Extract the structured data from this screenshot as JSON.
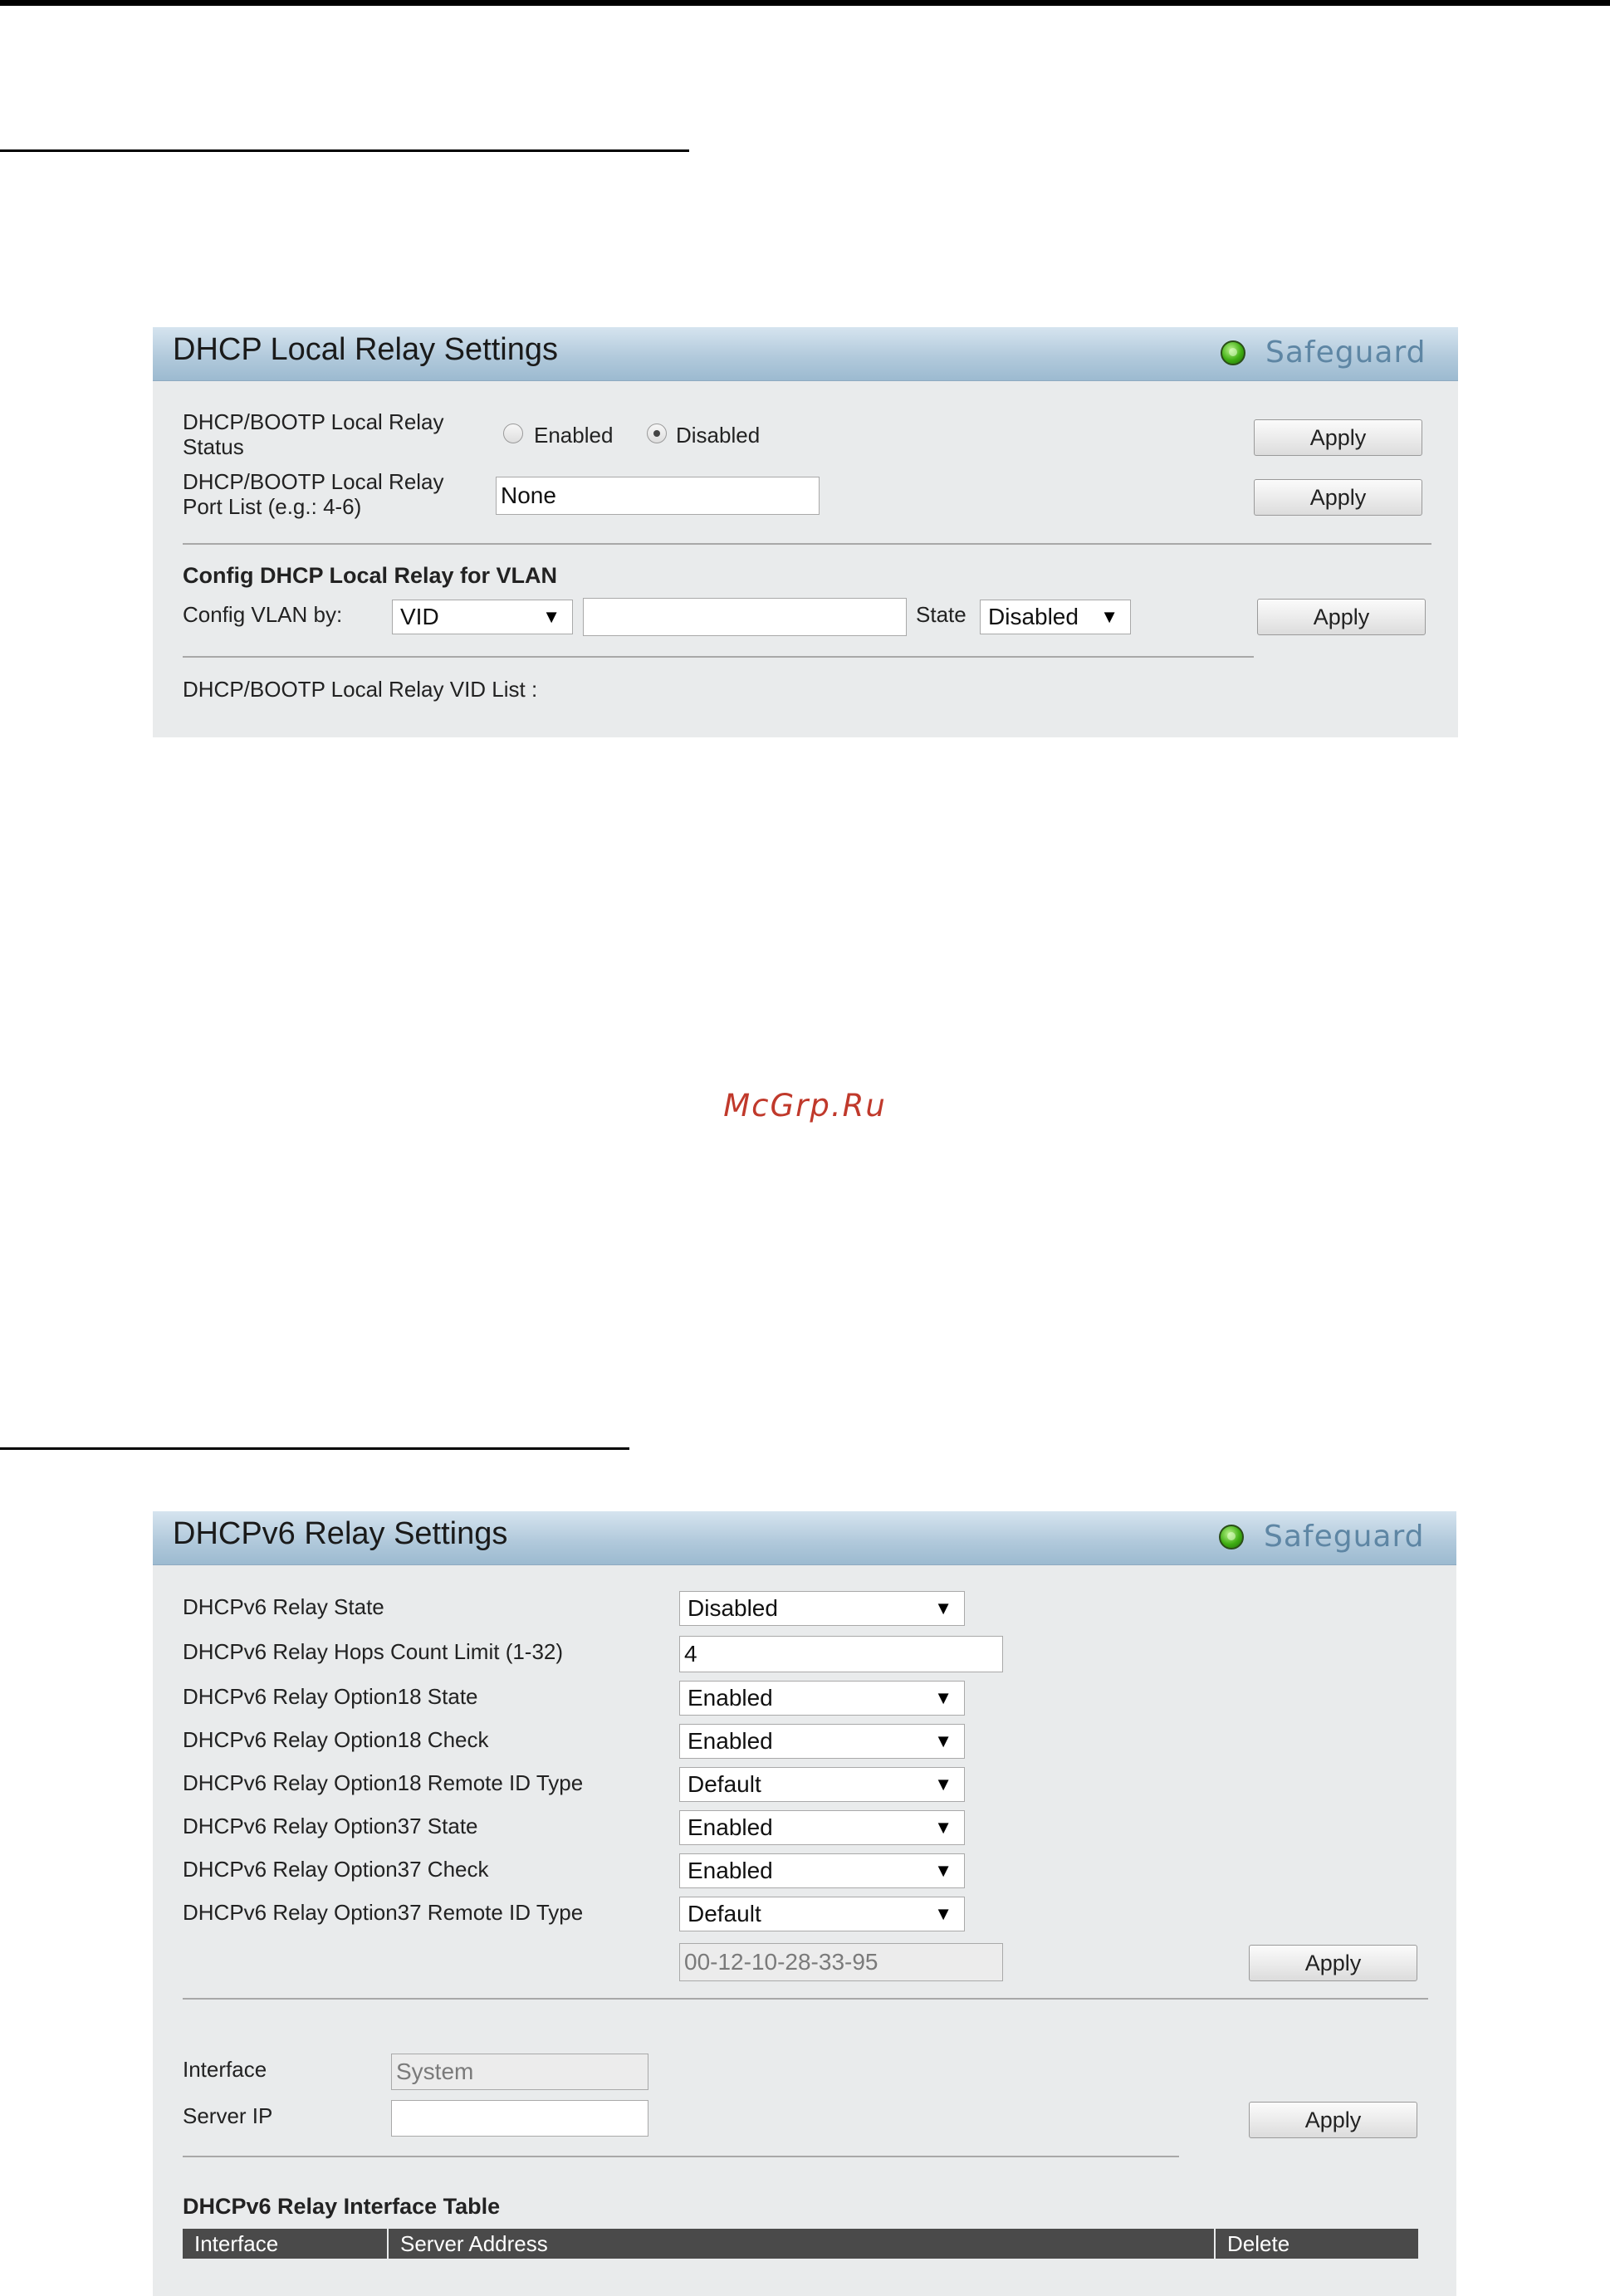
{
  "watermark": "McGrp.Ru",
  "local_relay": {
    "title": "DHCP Local Relay Settings",
    "safeguard": "Safeguard",
    "status_label_line1": "DHCP/BOOTP Local Relay",
    "status_label_line2": "Status",
    "status_options": [
      "Enabled",
      "Disabled"
    ],
    "status_selected": "Disabled",
    "portlist_label_line1": "DHCP/BOOTP Local Relay",
    "portlist_label_line2": "Port List (e.g.: 4-6)",
    "portlist_value": "None",
    "apply_label": "Apply",
    "vlan_section_title": "Config DHCP Local Relay for VLAN",
    "config_vlan_label": "Config VLAN by:",
    "config_vlan_selected": "VID",
    "config_vlan_value": "",
    "state_label": "State",
    "state_selected": "Disabled",
    "vid_list_label": "DHCP/BOOTP Local Relay VID List :"
  },
  "v6_relay": {
    "title": "DHCPv6 Relay Settings",
    "safeguard": "Safeguard",
    "rows": [
      {
        "label": "DHCPv6 Relay State",
        "value": "Disabled"
      },
      {
        "label": "DHCPv6 Relay Hops Count Limit (1-32)",
        "value": "4"
      },
      {
        "label": "DHCPv6 Relay Option18 State",
        "value": "Enabled"
      },
      {
        "label": "DHCPv6 Relay Option18 Check",
        "value": "Enabled"
      },
      {
        "label": "DHCPv6 Relay Option18 Remote ID Type",
        "value": "Default"
      },
      {
        "label": "DHCPv6 Relay Option37 State",
        "value": "Enabled"
      },
      {
        "label": "DHCPv6 Relay Option37 Check",
        "value": "Enabled"
      },
      {
        "label": "DHCPv6 Relay Option37 Remote ID Type",
        "value": "Default"
      }
    ],
    "remote_id_value": "00-12-10-28-33-95",
    "apply_label": "Apply",
    "interface_label": "Interface",
    "interface_value": "System",
    "server_ip_label": "Server IP",
    "server_ip_value": "",
    "table_title": "DHCPv6 Relay Interface Table",
    "table_headers": [
      "Interface",
      "Server Address",
      "Delete"
    ]
  }
}
